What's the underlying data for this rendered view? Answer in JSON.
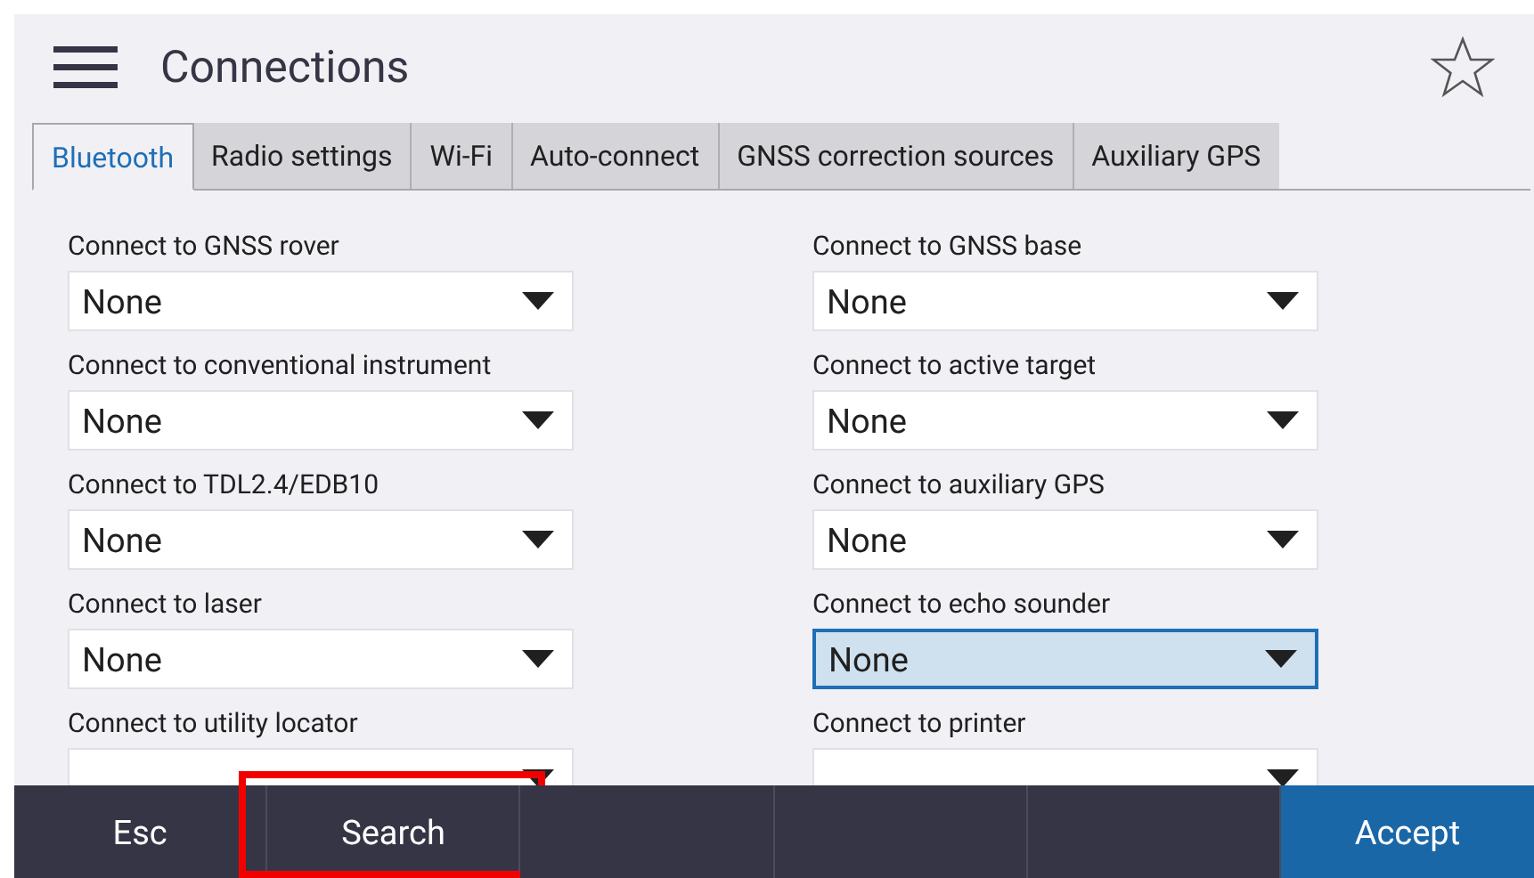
{
  "header": {
    "title": "Connections",
    "favorite": false
  },
  "tabs": [
    {
      "label": "Bluetooth",
      "selected": true
    },
    {
      "label": "Radio settings",
      "selected": false
    },
    {
      "label": "Wi-Fi",
      "selected": false
    },
    {
      "label": "Auto-connect",
      "selected": false
    },
    {
      "label": "GNSS correction sources",
      "selected": false
    },
    {
      "label": "Auxiliary GPS",
      "selected": false
    }
  ],
  "fields": [
    {
      "label": "Connect to GNSS rover",
      "value": "None",
      "selected": false
    },
    {
      "label": "Connect to GNSS base",
      "value": "None",
      "selected": false
    },
    {
      "label": "Connect to conventional instrument",
      "value": "None",
      "selected": false
    },
    {
      "label": "Connect to active target",
      "value": "None",
      "selected": false
    },
    {
      "label": "Connect to TDL2.4/EDB10",
      "value": "None",
      "selected": false
    },
    {
      "label": "Connect to auxiliary GPS",
      "value": "None",
      "selected": false
    },
    {
      "label": "Connect to laser",
      "value": "None",
      "selected": false
    },
    {
      "label": "Connect to echo sounder",
      "value": "None",
      "selected": true
    },
    {
      "label": "Connect to utility locator",
      "selected": false
    },
    {
      "label": "Connect to printer",
      "selected": false
    }
  ],
  "softkeys": [
    {
      "label": "Esc",
      "kind": "plain",
      "highlighted": false
    },
    {
      "label": "Search",
      "kind": "plain",
      "highlighted": true
    },
    {
      "kind": "empty",
      "highlighted": false
    },
    {
      "kind": "empty",
      "highlighted": false
    },
    {
      "kind": "empty",
      "highlighted": false
    },
    {
      "label": "Accept",
      "kind": "primary",
      "highlighted": false
    }
  ]
}
